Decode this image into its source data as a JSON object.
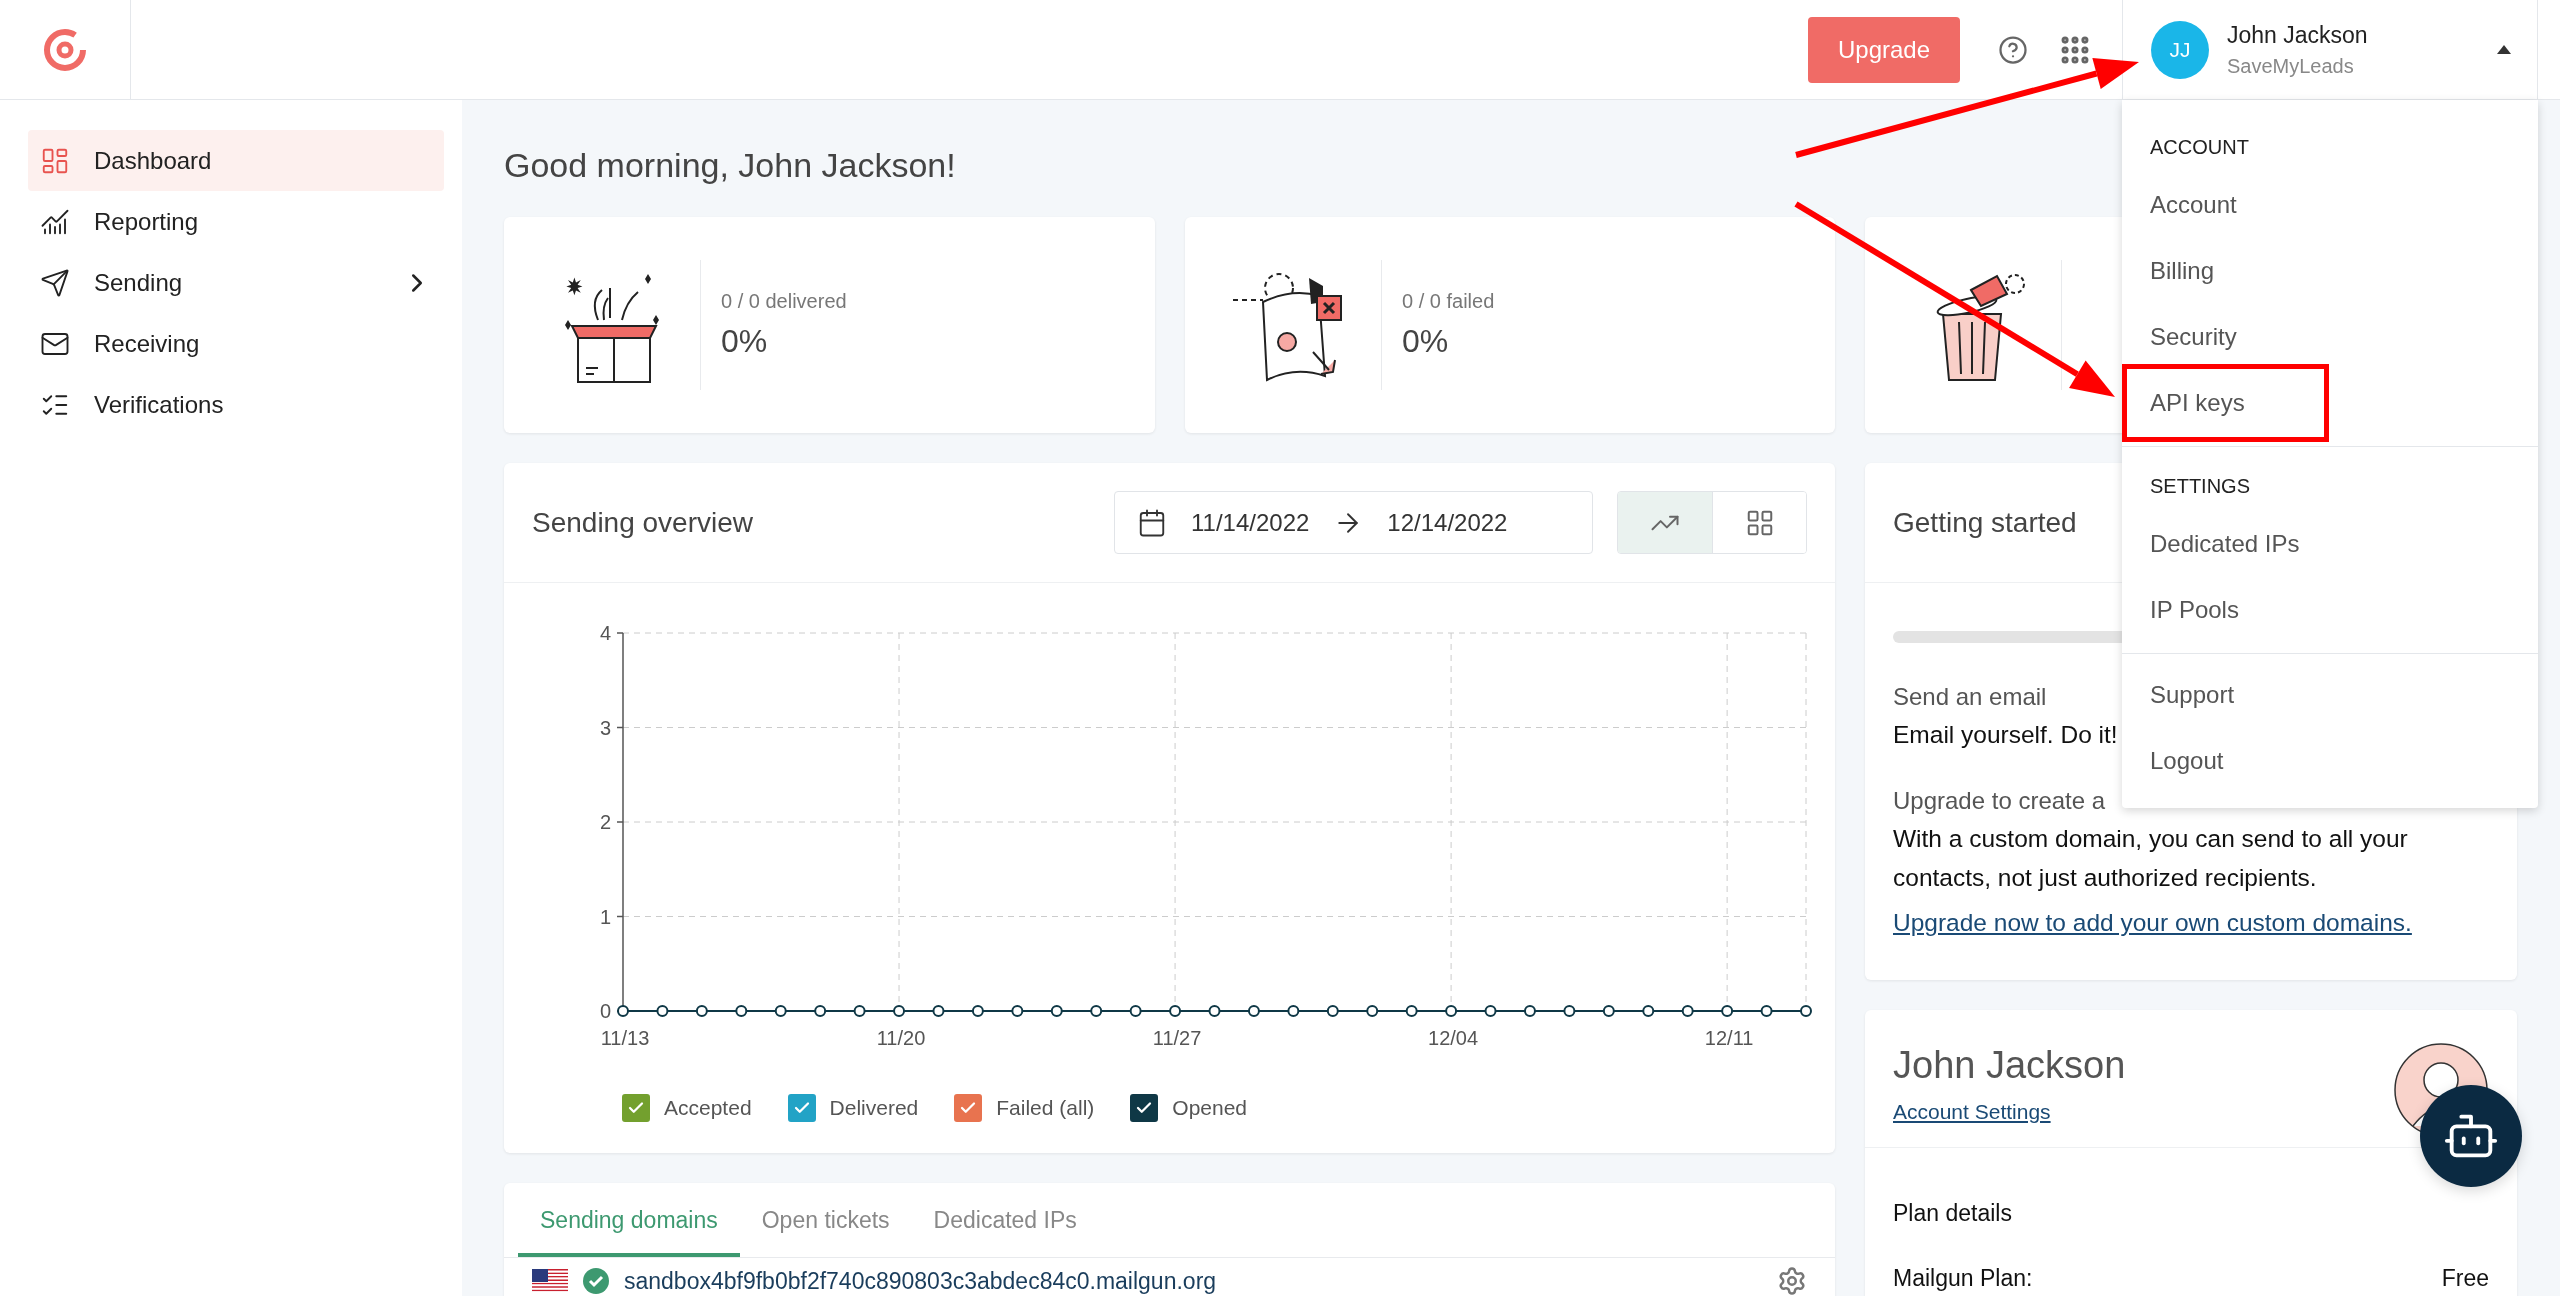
{
  "header": {
    "upgrade_button": "Upgrade",
    "user": {
      "initials": "JJ",
      "name": "John Jackson",
      "company": "SaveMyLeads",
      "highlighted": true
    },
    "menu_expanded": true
  },
  "sidebar": {
    "items": [
      {
        "label": "Dashboard",
        "selected": true,
        "submenu": false
      },
      {
        "label": "Reporting",
        "selected": false,
        "submenu": false
      },
      {
        "label": "Sending",
        "selected": false,
        "submenu": true
      },
      {
        "label": "Receiving",
        "selected": false,
        "submenu": false
      },
      {
        "label": "Verifications",
        "selected": false,
        "submenu": false
      }
    ]
  },
  "greeting": "Good morning, John Jackson!",
  "stat_cards": [
    {
      "kind": "stat",
      "caption": "0 / 0 delivered",
      "value": "0%"
    },
    {
      "kind": "stat",
      "caption": "0 / 0 failed",
      "value": "0%"
    },
    {
      "kind": "illustration"
    }
  ],
  "overview": {
    "title": "Sending overview",
    "date_range": {
      "start": "11/14/2022",
      "end": "12/14/2022"
    },
    "view_toggle": [
      {
        "selected": true
      },
      {
        "selected": false
      }
    ],
    "chart_data": {
      "type": "line",
      "grid": true,
      "categories": [
        "11/13",
        null,
        null,
        null,
        null,
        null,
        null,
        "11/20",
        null,
        null,
        null,
        null,
        null,
        null,
        "11/27",
        null,
        null,
        null,
        null,
        null,
        null,
        "12/04",
        null,
        null,
        null,
        null,
        null,
        null,
        "12/11",
        null,
        null
      ],
      "series": [
        {
          "name": "Opened",
          "color": "#0f3846",
          "marker": "circle",
          "values": [
            0,
            0,
            0,
            0,
            0,
            0,
            0,
            0,
            0,
            0,
            0,
            0,
            0,
            0,
            0,
            0,
            0,
            0,
            0,
            0,
            0,
            0,
            0,
            0,
            0,
            0,
            0,
            0,
            0,
            0,
            0
          ]
        }
      ],
      "ylim": [
        0,
        4
      ],
      "yticks": [
        0,
        1,
        2,
        3,
        4
      ]
    },
    "legend": [
      {
        "label": "Accepted",
        "checked": true,
        "color": "#73a02e"
      },
      {
        "label": "Delivered",
        "checked": true,
        "color": "#22a3c6"
      },
      {
        "label": "Failed (all)",
        "checked": true,
        "color": "#e8734f"
      }
    ],
    "series_legend": [
      {
        "checked": true
      }
    ]
  },
  "domains": {
    "tabs": [
      {
        "label": "Sending domains",
        "selected": true
      },
      {
        "label": "Open tickets",
        "selected": false
      },
      {
        "label": "Dedicated IPs",
        "selected": false
      }
    ],
    "rows": [
      {
        "domain": "sandbox4bf9fb0bf2f740c890803c3abdec84c0.mailgun.org",
        "verified": true
      }
    ]
  },
  "getting_started": {
    "title": "Getting started",
    "steps": [
      {
        "title": "Send an email",
        "text": "Email yourself. Do it!"
      },
      {
        "title": "Upgrade to create a",
        "text": "With a custom domain, you can send to all your contacts, not just authorized recipients.",
        "link": "Upgrade now to add your own custom domains."
      }
    ]
  },
  "account_card": {
    "name": "John Jackson",
    "link": "Account Settings",
    "plan_title": "Plan details",
    "plan_label": "Mailgun Plan:",
    "plan_value": "Free"
  },
  "user_menu": {
    "sections": [
      {
        "heading": "ACCOUNT",
        "items": [
          {
            "label": "Account",
            "highlighted": false
          },
          {
            "label": "Billing",
            "highlighted": false
          },
          {
            "label": "Security",
            "highlighted": false
          },
          {
            "label": "API keys",
            "highlighted": true
          }
        ]
      },
      {
        "heading": "SETTINGS",
        "items": [
          {
            "label": "Dedicated IPs",
            "highlighted": false
          },
          {
            "label": "IP Pools",
            "highlighted": false
          }
        ]
      },
      {
        "items": [
          {
            "label": "Support",
            "highlighted": false
          },
          {
            "label": "Logout",
            "highlighted": false
          }
        ]
      }
    ]
  }
}
